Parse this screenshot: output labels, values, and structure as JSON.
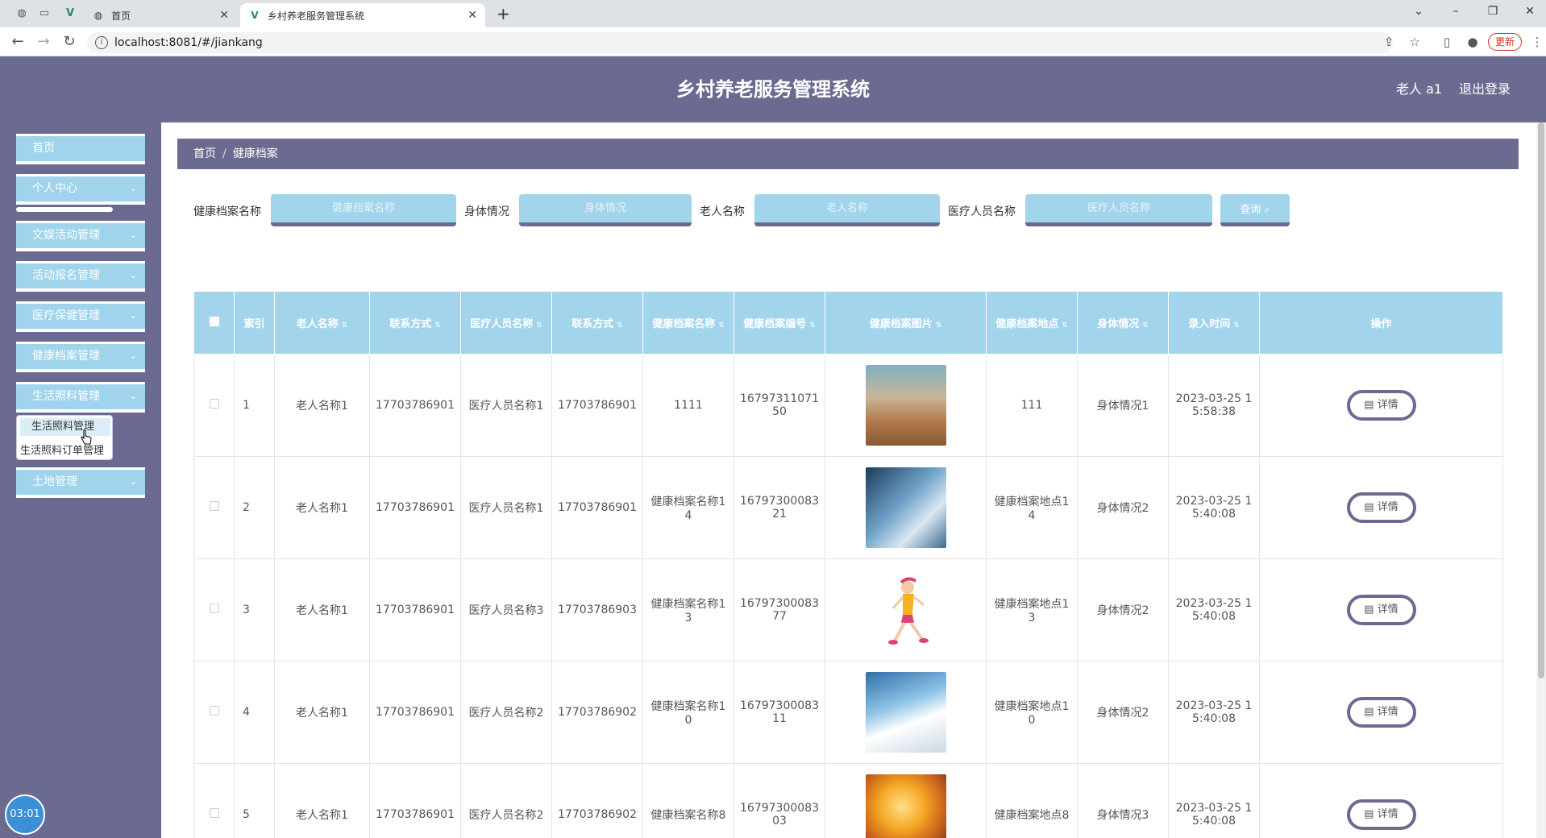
{
  "browser": {
    "tabs": [
      {
        "title": "首页"
      },
      {
        "title": "乡村养老服务管理系统"
      }
    ],
    "url": "localhost:8081/#/jiankang",
    "update_label": "更新"
  },
  "header": {
    "title": "乡村养老服务管理系统",
    "user": "老人 a1",
    "logout": "退出登录"
  },
  "sidebar": {
    "items": [
      {
        "label": "首页"
      },
      {
        "label": "个人中心"
      },
      {
        "label": "文娱活动管理"
      },
      {
        "label": "活动报名管理"
      },
      {
        "label": "医疗保健管理"
      },
      {
        "label": "健康档案管理"
      },
      {
        "label": "生活照料管理"
      },
      {
        "label": "土地管理"
      }
    ],
    "submenu": [
      "生活照料管理",
      "生活照料订单管理"
    ],
    "timer": "03:01"
  },
  "breadcrumb": {
    "home": "首页",
    "current": "健康档案"
  },
  "search": {
    "fields": [
      {
        "label": "健康档案名称",
        "placeholder": "健康档案名称"
      },
      {
        "label": "身体情况",
        "placeholder": "身体情况"
      },
      {
        "label": "老人名称",
        "placeholder": "老人名称"
      },
      {
        "label": "医疗人员名称",
        "placeholder": "医疗人员名称"
      }
    ],
    "button": "查询 ⌕"
  },
  "table": {
    "columns": [
      "索引",
      "老人名称",
      "联系方式",
      "医疗人员名称",
      "联系方式",
      "健康档案名称",
      "健康档案编号",
      "健康档案图片",
      "健康档案地点",
      "身体情况",
      "录入时间",
      "操作"
    ],
    "detail_label": "▤ 详情",
    "rows": [
      {
        "idx": "1",
        "elder": "老人名称1",
        "phone1": "17703786901",
        "medic": "医疗人员名称1",
        "phone2": "17703786901",
        "name": "1111",
        "code": "1679731107150",
        "place": "111",
        "body": "身体情况1",
        "time": "2023-03-25 15:58:38"
      },
      {
        "idx": "2",
        "elder": "老人名称1",
        "phone1": "17703786901",
        "medic": "医疗人员名称1",
        "phone2": "17703786901",
        "name": "健康档案名称14",
        "code": "1679730008321",
        "place": "健康档案地点14",
        "body": "身体情况2",
        "time": "2023-03-25 15:40:08"
      },
      {
        "idx": "3",
        "elder": "老人名称1",
        "phone1": "17703786901",
        "medic": "医疗人员名称3",
        "phone2": "17703786903",
        "name": "健康档案名称13",
        "code": "1679730008377",
        "place": "健康档案地点13",
        "body": "身体情况2",
        "time": "2023-03-25 15:40:08"
      },
      {
        "idx": "4",
        "elder": "老人名称1",
        "phone1": "17703786901",
        "medic": "医疗人员名称2",
        "phone2": "17703786902",
        "name": "健康档案名称10",
        "code": "1679730008311",
        "place": "健康档案地点10",
        "body": "身体情况2",
        "time": "2023-03-25 15:40:08"
      },
      {
        "idx": "5",
        "elder": "老人名称1",
        "phone1": "17703786901",
        "medic": "医疗人员名称2",
        "phone2": "17703786902",
        "name": "健康档案名称8",
        "code": "1679730008303",
        "place": "健康档案地点8",
        "body": "身体情况3",
        "time": "2023-03-25 15:40:08"
      }
    ]
  },
  "colors": {
    "primary": "#6b6b91",
    "accent": "#a2d5ec"
  }
}
